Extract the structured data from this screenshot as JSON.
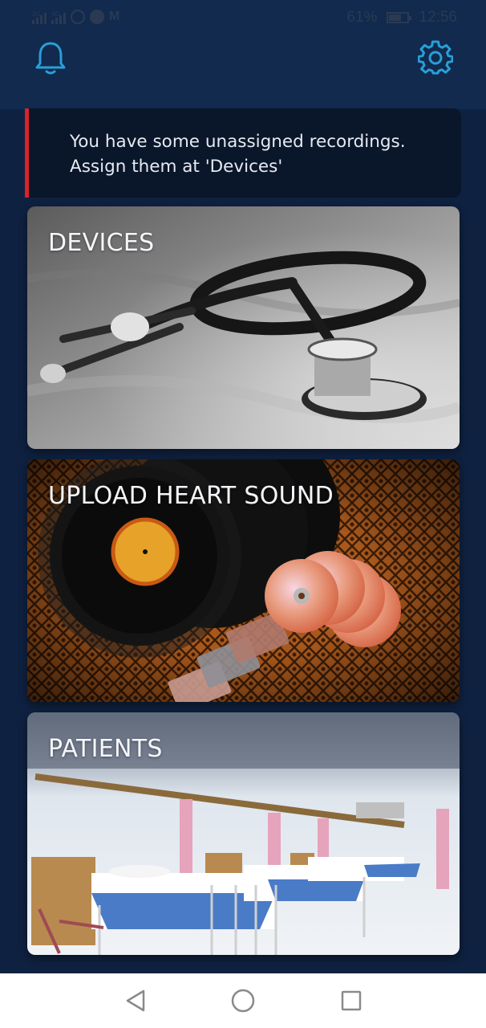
{
  "status": {
    "net1": "3G",
    "net2": "4G",
    "battery": "61%",
    "time": "12:56",
    "battery_level": 0.61
  },
  "header": {
    "left_icon": "bell-icon",
    "right_icon": "gear-icon",
    "accent": "#2a9fd6"
  },
  "alert": {
    "line1": "You have some unassigned recordings.",
    "line2": "Assign them at 'Devices'",
    "accent": "#d9222a"
  },
  "tiles": [
    {
      "label": "DEVICES",
      "image": "stethoscope"
    },
    {
      "label": "UPLOAD HEART SOUND",
      "image": "vinyl-records-cds-cassettes"
    },
    {
      "label": "PATIENTS",
      "image": "hospital-ward-beds"
    }
  ],
  "navbar": {
    "back_icon": "back-triangle-icon",
    "home_icon": "home-circle-icon",
    "recents_icon": "recents-square-icon"
  }
}
